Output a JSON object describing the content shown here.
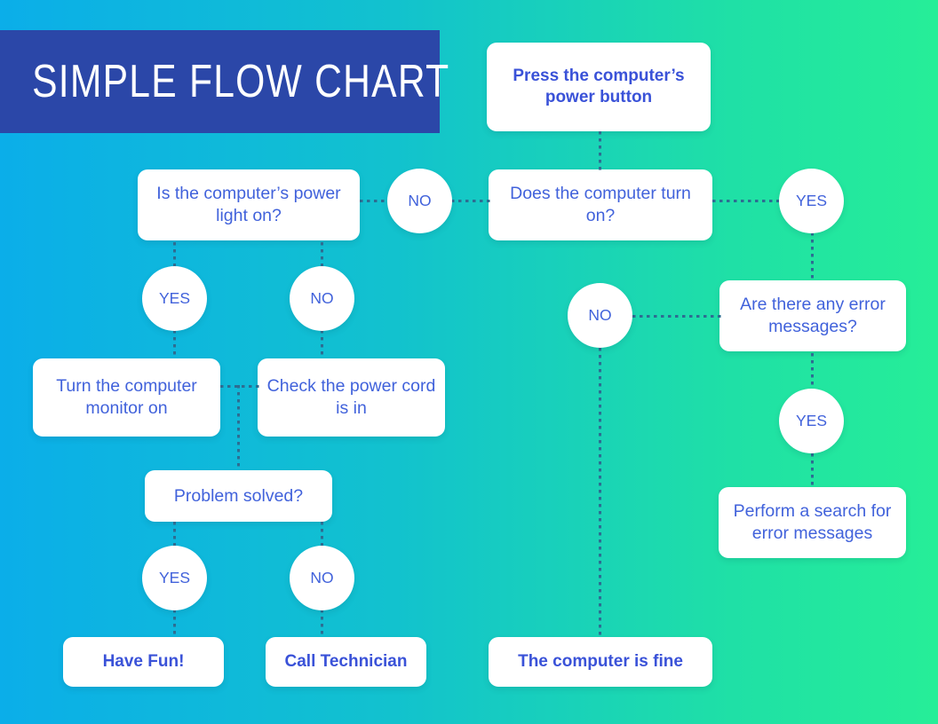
{
  "title": "SIMPLE FLOW CHART",
  "theme": {
    "bg_left": "#0BAEE9",
    "bg_right": "#26EE98",
    "banner_bg": "#2B47A8",
    "banner_text": "#FFFFFF",
    "node_bg": "#FFFFFF",
    "node_text": "#4162DB",
    "connector": "#2D6D92"
  },
  "chart_data": {
    "type": "diagram",
    "title": "SIMPLE FLOW CHART",
    "nodes": [
      {
        "id": "start",
        "label": "Press the computer’s power button",
        "shape": "box",
        "style": "bold"
      },
      {
        "id": "turn_on",
        "label": "Does the computer turn on?",
        "shape": "box",
        "style": "regular"
      },
      {
        "id": "power_light",
        "label": "Is the computer’s power light on?",
        "shape": "box",
        "style": "regular"
      },
      {
        "id": "errors",
        "label": "Are there any error messages?",
        "shape": "box",
        "style": "regular"
      },
      {
        "id": "monitor_on",
        "label": "Turn the computer monitor on",
        "shape": "box",
        "style": "regular"
      },
      {
        "id": "power_cord",
        "label": "Check the power cord is in",
        "shape": "box",
        "style": "regular"
      },
      {
        "id": "solved",
        "label": "Problem solved?",
        "shape": "box",
        "style": "regular"
      },
      {
        "id": "search",
        "label": "Perform a search for error messages",
        "shape": "box",
        "style": "regular"
      },
      {
        "id": "have_fun",
        "label": "Have Fun!",
        "shape": "box",
        "style": "bold"
      },
      {
        "id": "call_tech",
        "label": "Call Technician",
        "shape": "box",
        "style": "bold"
      },
      {
        "id": "fine",
        "label": "The computer is fine",
        "shape": "box",
        "style": "bold"
      }
    ],
    "edge_labels": [
      {
        "id": "no_turn_on",
        "label": "NO",
        "shape": "circle"
      },
      {
        "id": "yes_turn_on",
        "label": "YES",
        "shape": "circle"
      },
      {
        "id": "yes_light",
        "label": "YES",
        "shape": "circle"
      },
      {
        "id": "no_light",
        "label": "NO",
        "shape": "circle"
      },
      {
        "id": "no_errors",
        "label": "NO",
        "shape": "circle"
      },
      {
        "id": "yes_errors",
        "label": "YES",
        "shape": "circle"
      },
      {
        "id": "yes_solved",
        "label": "YES",
        "shape": "circle"
      },
      {
        "id": "no_solved",
        "label": "NO",
        "shape": "circle"
      }
    ],
    "edges": [
      {
        "from": "start",
        "to": "turn_on",
        "label": ""
      },
      {
        "from": "turn_on",
        "to": "power_light",
        "label": "NO"
      },
      {
        "from": "turn_on",
        "to": "errors",
        "label": "YES"
      },
      {
        "from": "power_light",
        "to": "monitor_on",
        "label": "YES"
      },
      {
        "from": "power_light",
        "to": "power_cord",
        "label": "NO"
      },
      {
        "from": "monitor_on",
        "to": "solved",
        "label": ""
      },
      {
        "from": "power_cord",
        "to": "solved",
        "label": ""
      },
      {
        "from": "solved",
        "to": "have_fun",
        "label": "YES"
      },
      {
        "from": "solved",
        "to": "call_tech",
        "label": "NO"
      },
      {
        "from": "errors",
        "to": "search",
        "label": "YES"
      },
      {
        "from": "errors",
        "to": "fine",
        "label": "NO"
      }
    ]
  },
  "nodes": {
    "start": "Press the computer’s power button",
    "turn_on": "Does the computer turn on?",
    "power_light": "Is the computer’s power light on?",
    "errors": "Are there any error messages?",
    "monitor_on": "Turn the computer monitor on",
    "power_cord": "Check the power cord is in",
    "solved": "Problem solved?",
    "search": "Perform a search for error messages",
    "have_fun": "Have Fun!",
    "call_tech": "Call Technician",
    "fine": "The computer is fine"
  },
  "labels": {
    "no_turn_on": "NO",
    "yes_turn_on": "YES",
    "yes_light": "YES",
    "no_light": "NO",
    "no_errors": "NO",
    "yes_errors": "YES",
    "yes_solved": "YES",
    "no_solved": "NO"
  }
}
